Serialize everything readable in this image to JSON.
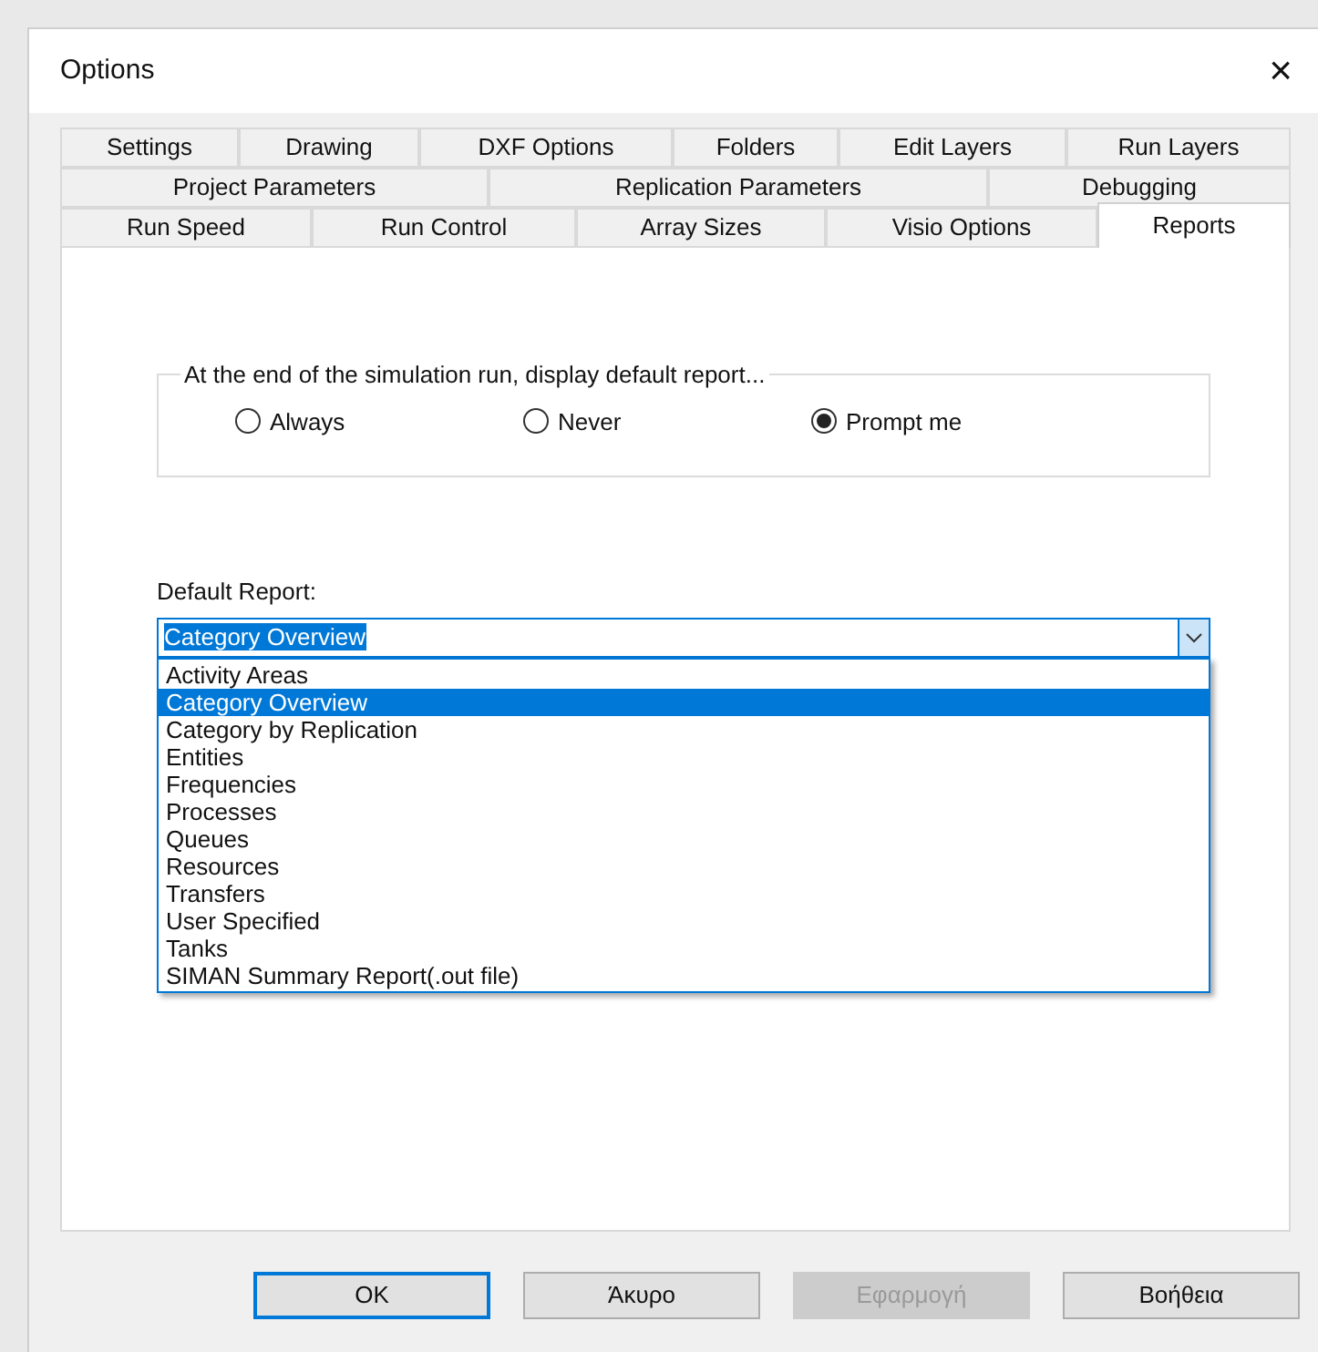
{
  "window": {
    "title": "Options",
    "close": "×"
  },
  "tab_rows": [
    [
      {
        "label": "Settings",
        "selected": false
      },
      {
        "label": "Drawing",
        "selected": false
      },
      {
        "label": "DXF Options",
        "selected": false
      },
      {
        "label": "Folders",
        "selected": false
      },
      {
        "label": "Edit Layers",
        "selected": false
      },
      {
        "label": "Run Layers",
        "selected": false
      }
    ],
    [
      {
        "label": "Project Parameters",
        "selected": false
      },
      {
        "label": "Replication Parameters",
        "selected": false
      },
      {
        "label": "Debugging",
        "selected": false
      }
    ],
    [
      {
        "label": "Run Speed",
        "selected": false
      },
      {
        "label": "Run Control",
        "selected": false
      },
      {
        "label": "Array Sizes",
        "selected": false
      },
      {
        "label": "Visio Options",
        "selected": false
      },
      {
        "label": "Reports",
        "selected": true
      }
    ]
  ],
  "group": {
    "legend": "At the end of the simulation run, display default report...",
    "options": [
      {
        "label": "Always",
        "selected": false
      },
      {
        "label": "Never",
        "selected": false
      },
      {
        "label": "Prompt me",
        "selected": true
      }
    ]
  },
  "default_report": {
    "label": "Default Report:",
    "value": "Category Overview",
    "expanded": true,
    "items": [
      {
        "label": "Activity Areas",
        "selected": false
      },
      {
        "label": "Category Overview",
        "selected": true
      },
      {
        "label": "Category by Replication",
        "selected": false
      },
      {
        "label": "Entities",
        "selected": false
      },
      {
        "label": "Frequencies",
        "selected": false
      },
      {
        "label": "Processes",
        "selected": false
      },
      {
        "label": "Queues",
        "selected": false
      },
      {
        "label": "Resources",
        "selected": false
      },
      {
        "label": "Transfers",
        "selected": false
      },
      {
        "label": "User Specified",
        "selected": false
      },
      {
        "label": "Tanks",
        "selected": false
      },
      {
        "label": "SIMAN Summary Report(.out file)",
        "selected": false
      }
    ]
  },
  "buttons": [
    {
      "label": "OK",
      "kind": "default",
      "disabled": false
    },
    {
      "label": "Άκυρο",
      "kind": "normal",
      "disabled": false
    },
    {
      "label": "Εφαρμογή",
      "kind": "normal",
      "disabled": true
    },
    {
      "label": "Βοήθεια",
      "kind": "normal",
      "disabled": false
    }
  ]
}
